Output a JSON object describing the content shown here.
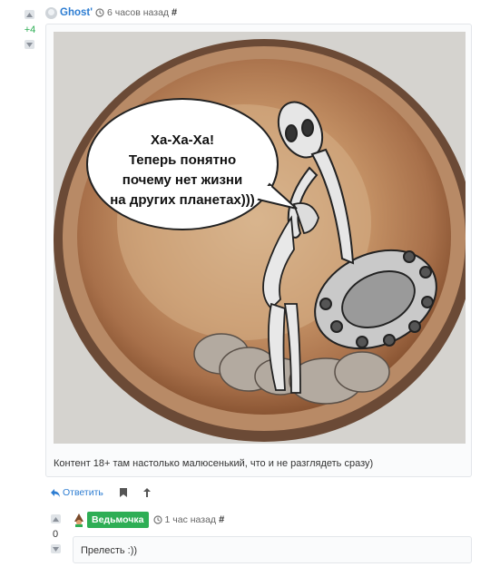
{
  "comment1": {
    "score": "+4",
    "author": "Ghost'",
    "time": "6 часов назад",
    "hash": "#",
    "speech_text": [
      "Ха-Ха-Ха!",
      "Теперь понятно",
      "почему нет жизни",
      "на других планетах)))"
    ],
    "caption": "Контент 18+ там настолько малюсенький, что и не разглядеть сразу)",
    "actions": {
      "reply": "Ответить"
    }
  },
  "comment2": {
    "score": "0",
    "author": "Ведьмочка",
    "time": "1 час назад",
    "hash": "#",
    "text": "Прелесть :))"
  },
  "colors": {
    "accent": "#2d7dd2",
    "badge": "#2eae55",
    "score_positive": "#2eae55"
  },
  "icons": [
    "vote-up-icon",
    "vote-down-icon",
    "history-icon",
    "reply-icon",
    "bookmark-icon",
    "arrow-up-icon"
  ]
}
